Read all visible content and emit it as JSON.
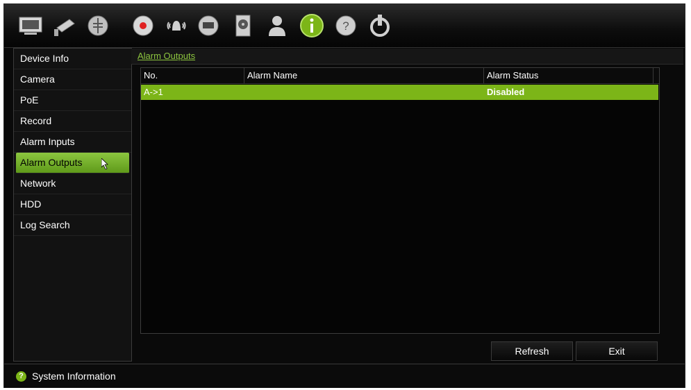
{
  "toolbar": {
    "icons": [
      "monitor-icon",
      "camera-icon",
      "ptz-icon",
      "record-icon",
      "alarm-icon",
      "network-icon",
      "hdd-icon",
      "user-icon",
      "info-icon",
      "help-icon",
      "power-icon"
    ],
    "active_icon": "info-icon"
  },
  "sidebar": {
    "items": [
      {
        "label": "Device Info"
      },
      {
        "label": "Camera"
      },
      {
        "label": "PoE"
      },
      {
        "label": "Record"
      },
      {
        "label": "Alarm Inputs"
      },
      {
        "label": "Alarm Outputs"
      },
      {
        "label": "Network"
      },
      {
        "label": "HDD"
      },
      {
        "label": "Log Search"
      }
    ],
    "active": "Alarm Outputs"
  },
  "main": {
    "title": "Alarm Outputs",
    "table": {
      "columns": [
        "No.",
        "Alarm Name",
        "Alarm Status"
      ],
      "rows": [
        {
          "no": "A->1",
          "name": "",
          "status": "Disabled"
        }
      ]
    },
    "buttons": {
      "refresh": "Refresh",
      "exit": "Exit"
    }
  },
  "statusbar": {
    "text": "System Information"
  },
  "colors": {
    "accent": "#7cb518",
    "background": "#0a0a0a"
  }
}
